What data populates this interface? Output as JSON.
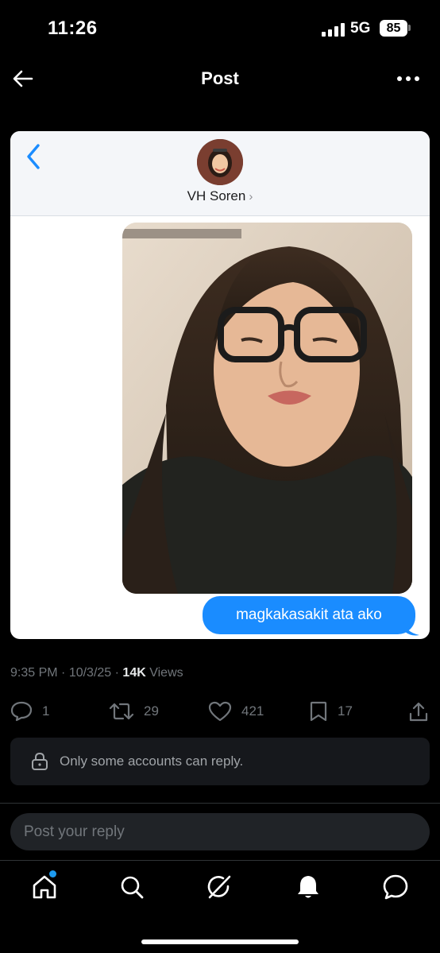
{
  "status_bar": {
    "time": "11:26",
    "network": "5G",
    "battery": "85"
  },
  "nav": {
    "title": "Post"
  },
  "imessage": {
    "contact_name": "VH Soren",
    "message": "magkakasakit ata ako",
    "bubble_color": "#1a8cff"
  },
  "post": {
    "time": "9:35 PM",
    "date": "10/3/25",
    "views_count": "14K",
    "views_label": "Views"
  },
  "actions": {
    "replies": "1",
    "reposts": "29",
    "likes": "421",
    "bookmarks": "17"
  },
  "reply_restriction": "Only some accounts can reply.",
  "reply_box": {
    "placeholder": "Post your reply"
  },
  "tabbar": {
    "items": [
      "home-icon",
      "search-icon",
      "grok-icon",
      "notifications-icon",
      "messages-icon"
    ],
    "accent": "#1d9bf0"
  }
}
